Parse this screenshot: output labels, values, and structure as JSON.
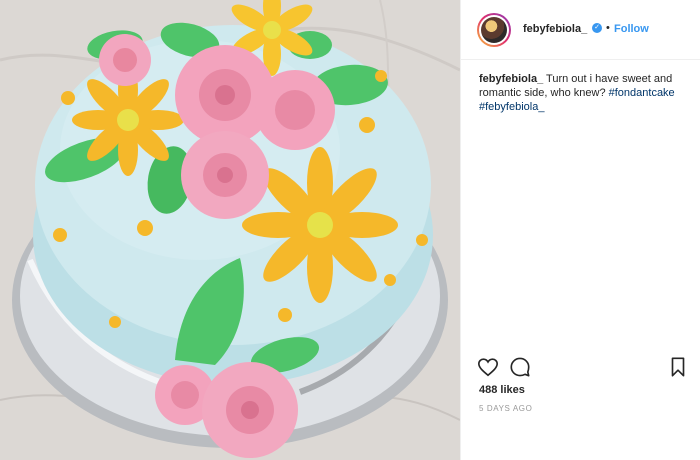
{
  "post": {
    "username": "febyfebiola_",
    "follow_label": "Follow",
    "separator": "•",
    "caption": {
      "user": "febyfebiola_",
      "text": " Turn out i have sweet and romantic side, who knew? ",
      "tag1": "#fondantcake",
      "tag2": "#febyfebiola_"
    },
    "likes": "488 likes",
    "time": "5 DAYS AGO"
  },
  "icons": {
    "like": "heart-icon",
    "comment": "comment-icon",
    "save": "bookmark-icon",
    "verified": "verified-badge-icon"
  },
  "colors": {
    "link": "#3897f0",
    "hashtag": "#003569",
    "text": "#262626",
    "muted": "#999999"
  }
}
